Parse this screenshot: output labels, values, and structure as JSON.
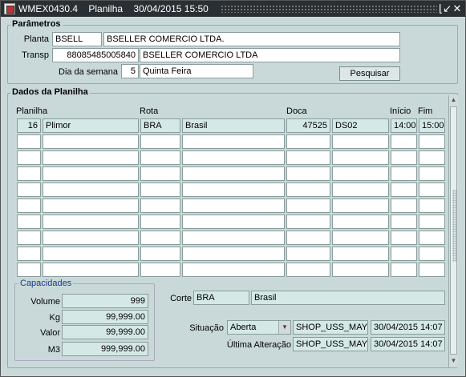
{
  "window": {
    "title": "WMEX0430.4    Planilha    30/04/2015 15:50",
    "minimize_glyph": "⌊↙",
    "close_glyph": "✕"
  },
  "parametros": {
    "label": "Parâmetros",
    "planta_label": "Planta",
    "planta_code": "BSELL",
    "planta_name": "BSELLER COMERCIO LTDA.",
    "transp_label": "Transp",
    "transp_code": "88085485005840",
    "transp_name": "BSELLER COMERCIO LTDA",
    "dia_label": "Dia da semana",
    "dia_num": "5",
    "dia_name": "Quinta Feira",
    "pesquisar_label": "Pesquisar"
  },
  "planilha": {
    "label": "Dados da Planilha",
    "headers": {
      "planilha": "Planilha",
      "rota": "Rota",
      "doca": "Doca",
      "inicio": "Início",
      "fim": "Fim"
    },
    "rows": [
      {
        "num": "16",
        "nome": "Plimor",
        "rota": "BRA",
        "rota_desc": "Brasil",
        "doca_num": "47525",
        "doca": "DS02",
        "inicio": "14:00",
        "fim": "15:00"
      },
      {
        "num": "",
        "nome": "",
        "rota": "",
        "rota_desc": "",
        "doca_num": "",
        "doca": "",
        "inicio": "",
        "fim": ""
      },
      {
        "num": "",
        "nome": "",
        "rota": "",
        "rota_desc": "",
        "doca_num": "",
        "doca": "",
        "inicio": "",
        "fim": ""
      },
      {
        "num": "",
        "nome": "",
        "rota": "",
        "rota_desc": "",
        "doca_num": "",
        "doca": "",
        "inicio": "",
        "fim": ""
      },
      {
        "num": "",
        "nome": "",
        "rota": "",
        "rota_desc": "",
        "doca_num": "",
        "doca": "",
        "inicio": "",
        "fim": ""
      },
      {
        "num": "",
        "nome": "",
        "rota": "",
        "rota_desc": "",
        "doca_num": "",
        "doca": "",
        "inicio": "",
        "fim": ""
      },
      {
        "num": "",
        "nome": "",
        "rota": "",
        "rota_desc": "",
        "doca_num": "",
        "doca": "",
        "inicio": "",
        "fim": ""
      },
      {
        "num": "",
        "nome": "",
        "rota": "",
        "rota_desc": "",
        "doca_num": "",
        "doca": "",
        "inicio": "",
        "fim": ""
      },
      {
        "num": "",
        "nome": "",
        "rota": "",
        "rota_desc": "",
        "doca_num": "",
        "doca": "",
        "inicio": "",
        "fim": ""
      },
      {
        "num": "",
        "nome": "",
        "rota": "",
        "rota_desc": "",
        "doca_num": "",
        "doca": "",
        "inicio": "",
        "fim": ""
      }
    ]
  },
  "capacidades": {
    "label": "Capacidades",
    "volume_label": "Volume",
    "volume": "999",
    "kg_label": "Kg",
    "kg": "99,999.00",
    "valor_label": "Valor",
    "valor": "99,999.00",
    "m3_label": "M3",
    "m3": "999,999.00"
  },
  "detalhe": {
    "corte_label": "Corte",
    "corte_code": "BRA",
    "corte_desc": "Brasil",
    "situacao_label": "Situação",
    "situacao_value": "Aberta",
    "situacao_user": "SHOP_USS_MAYC",
    "situacao_date": "30/04/2015 14:07",
    "alteracao_label": "Última Alteração",
    "alteracao_user": "SHOP_USS_MAYC",
    "alteracao_date": "30/04/2015 14:07"
  }
}
